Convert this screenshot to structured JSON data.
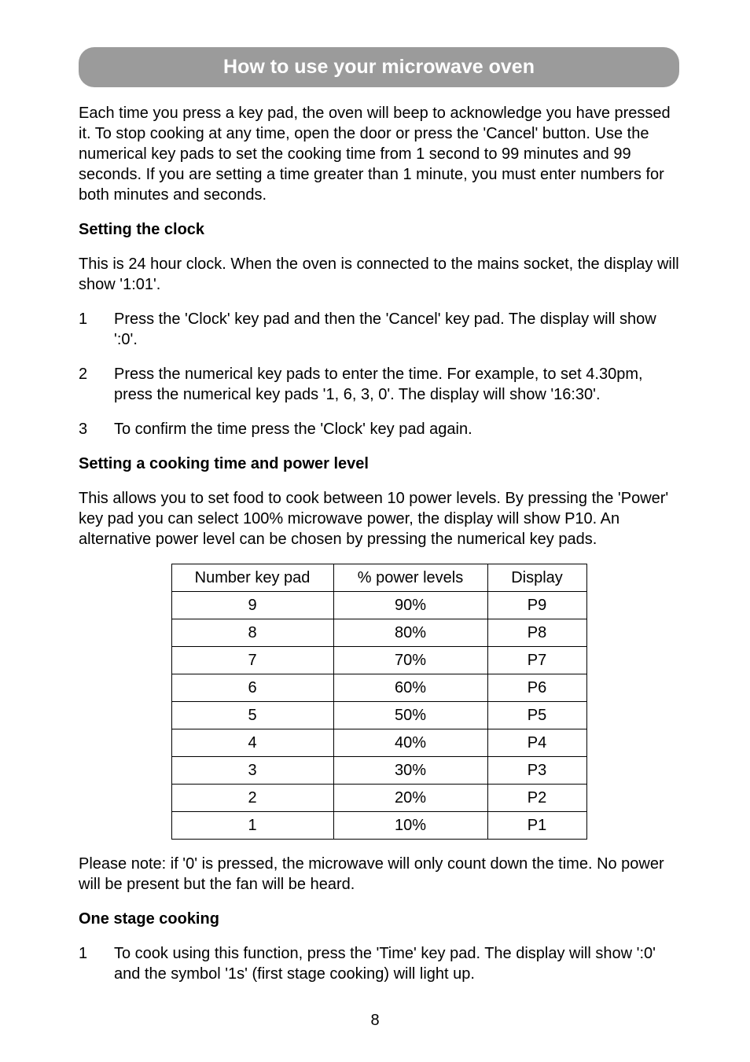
{
  "banner": {
    "title": "How to use your microwave oven"
  },
  "intro": "Each time you press a key pad, the oven will beep to acknowledge you have pressed it. To stop cooking at any time, open the door or press the 'Cancel' button. Use the numerical key pads to set the cooking time from 1 second to 99 minutes and 99 seconds. If you are setting a time greater than 1 minute, you must enter numbers for both minutes and seconds.",
  "clock": {
    "heading": "Setting the clock",
    "desc": "This is 24 hour clock. When the oven is connected to the mains socket, the display will show '1:01'.",
    "steps": [
      {
        "n": "1",
        "t": "Press the 'Clock' key pad and then the 'Cancel' key pad. The display will show ':0'."
      },
      {
        "n": "2",
        "t": "Press the numerical key pads to enter the time. For example, to set 4.30pm, press the numerical key pads '1, 6, 3, 0'. The display will show '16:30'."
      },
      {
        "n": "3",
        "t": "To confirm the time press the 'Clock' key pad again."
      }
    ]
  },
  "power": {
    "heading": "Setting a cooking time and power level",
    "desc": "This allows you to set food to cook between 10 power levels. By pressing the 'Power' key pad you can select 100% microwave power, the display will show P10. An alternative power level can be chosen by pressing the numerical key pads.",
    "table": {
      "headers": [
        "Number key pad",
        "% power levels",
        "Display"
      ],
      "rows": [
        [
          "9",
          "90%",
          "P9"
        ],
        [
          "8",
          "80%",
          "P8"
        ],
        [
          "7",
          "70%",
          "P7"
        ],
        [
          "6",
          "60%",
          "P6"
        ],
        [
          "5",
          "50%",
          "P5"
        ],
        [
          "4",
          "40%",
          "P4"
        ],
        [
          "3",
          "30%",
          "P3"
        ],
        [
          "2",
          "20%",
          "P2"
        ],
        [
          "1",
          "10%",
          "P1"
        ]
      ]
    },
    "note": "Please note: if '0' is pressed, the microwave will only count down the time. No power will be present but the fan will be heard."
  },
  "onestage": {
    "heading": "One stage cooking",
    "steps": [
      {
        "n": "1",
        "t": "To cook using this function, press the 'Time' key pad. The display will show ':0' and the symbol '1s' (first stage cooking) will light up."
      }
    ]
  },
  "pagenum": "8",
  "chart_data": {
    "type": "table",
    "title": "Power level table",
    "headers": [
      "Number key pad",
      "% power levels",
      "Display"
    ],
    "rows": [
      {
        "Number key pad": 9,
        "% power levels": "90%",
        "Display": "P9"
      },
      {
        "Number key pad": 8,
        "% power levels": "80%",
        "Display": "P8"
      },
      {
        "Number key pad": 7,
        "% power levels": "70%",
        "Display": "P7"
      },
      {
        "Number key pad": 6,
        "% power levels": "60%",
        "Display": "P6"
      },
      {
        "Number key pad": 5,
        "% power levels": "50%",
        "Display": "P5"
      },
      {
        "Number key pad": 4,
        "% power levels": "40%",
        "Display": "P4"
      },
      {
        "Number key pad": 3,
        "% power levels": "30%",
        "Display": "P3"
      },
      {
        "Number key pad": 2,
        "% power levels": "20%",
        "Display": "P2"
      },
      {
        "Number key pad": 1,
        "% power levels": "10%",
        "Display": "P1"
      }
    ]
  }
}
